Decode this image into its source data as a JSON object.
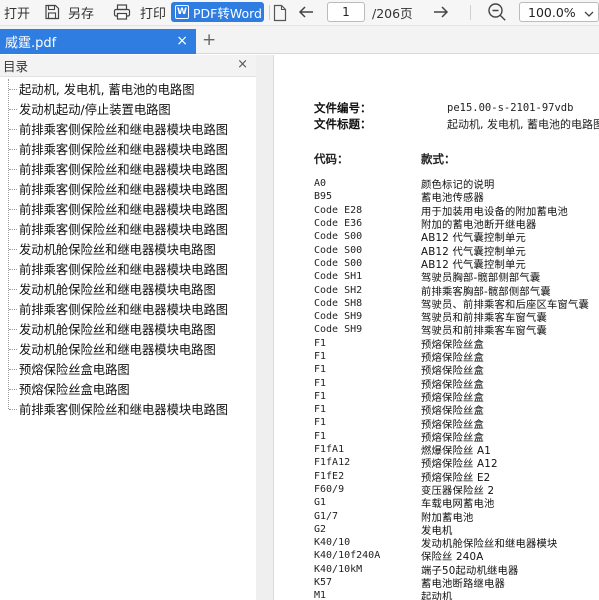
{
  "toolbar": {
    "open_label": "打开",
    "save_as_label": "另存",
    "print_label": "打印",
    "pdf_to_word_label": "PDF转Word",
    "word_icon_letter": "W",
    "current_page": "1",
    "total_pages": "/206页",
    "zoom": "100.0%"
  },
  "tab": {
    "title": "威霆.pdf",
    "close": "×",
    "new_tab": "+"
  },
  "sidebar": {
    "title": "目录",
    "close": "×",
    "items": [
      "起动机, 发电机, 蓄电池的电路图",
      "发动机起动/停止装置电路图",
      "前排乘客侧保险丝和继电器模块电路图",
      "前排乘客侧保险丝和继电器模块电路图",
      "前排乘客侧保险丝和继电器模块电路图",
      "前排乘客侧保险丝和继电器模块电路图",
      "前排乘客侧保险丝和继电器模块电路图",
      "前排乘客侧保险丝和继电器模块电路图",
      "发动机舱保险丝和继电器模块电路图",
      "前排乘客侧保险丝和继电器模块电路图",
      "发动机舱保险丝和继电器模块电路图",
      "前排乘客侧保险丝和继电器模块电路图",
      "发动机舱保险丝和继电器模块电路图",
      "发动机舱保险丝和继电器模块电路图",
      "预熔保险丝盒电路图",
      "预熔保险丝盒电路图",
      "前排乘客侧保险丝和继电器模块电路图"
    ]
  },
  "document": {
    "file_number_label": "文件编号：",
    "file_number": "pe15.00-s-2101-97vdb",
    "file_title_label": "文件标题：",
    "file_title": "起动机, 发电机, 蓄电池的电路图",
    "code_header": "代码：",
    "item_header": "款式：",
    "codes": [
      {
        "code": "A0",
        "desc": "颜色标记的说明"
      },
      {
        "code": "B95",
        "desc": "蓄电池传感器"
      },
      {
        "code": "Code E28",
        "desc": "用于加装用电设备的附加蓄电池"
      },
      {
        "code": "Code E36",
        "desc": "附加的蓄电池断开继电器"
      },
      {
        "code": "Code S00",
        "desc": "AB12 代气囊控制单元"
      },
      {
        "code": "Code S00",
        "desc": "AB12 代气囊控制单元"
      },
      {
        "code": "Code S00",
        "desc": "AB12 代气囊控制单元"
      },
      {
        "code": "Code SH1",
        "desc": "驾驶员胸部-髋部侧部气囊"
      },
      {
        "code": "Code SH2",
        "desc": "前排乘客胸部-髋部侧部气囊"
      },
      {
        "code": "Code SH8",
        "desc": "驾驶员、前排乘客和后座区车窗气囊"
      },
      {
        "code": "Code SH9",
        "desc": "驾驶员和前排乘客车窗气囊"
      },
      {
        "code": "Code SH9",
        "desc": "驾驶员和前排乘客车窗气囊"
      },
      {
        "code": "F1",
        "desc": "预熔保险丝盒"
      },
      {
        "code": "F1",
        "desc": "预熔保险丝盒"
      },
      {
        "code": "F1",
        "desc": "预熔保险丝盒"
      },
      {
        "code": "F1",
        "desc": "预熔保险丝盒"
      },
      {
        "code": "F1",
        "desc": "预熔保险丝盒"
      },
      {
        "code": "F1",
        "desc": "预熔保险丝盒"
      },
      {
        "code": "F1",
        "desc": "预熔保险丝盒"
      },
      {
        "code": "F1",
        "desc": "预熔保险丝盒"
      },
      {
        "code": "F1fA1",
        "desc": "燃爆保险丝 A1"
      },
      {
        "code": "F1fA12",
        "desc": "预熔保险丝 A12"
      },
      {
        "code": "F1fE2",
        "desc": "预熔保险丝 E2"
      },
      {
        "code": "F60/9",
        "desc": "变压器保险丝 2"
      },
      {
        "code": "G1",
        "desc": "车载电网蓄电池"
      },
      {
        "code": "G1/7",
        "desc": "附加蓄电池"
      },
      {
        "code": "G2",
        "desc": "发电机"
      },
      {
        "code": "K40/10",
        "desc": "发动机舱保险丝和继电器模块"
      },
      {
        "code": "K40/10f240A",
        "desc": "保险丝 240A"
      },
      {
        "code": "K40/10kM",
        "desc": "端子50起动机继电器"
      },
      {
        "code": "K57",
        "desc": "蓄电池断路继电器"
      },
      {
        "code": "M1",
        "desc": "起动机"
      }
    ]
  }
}
